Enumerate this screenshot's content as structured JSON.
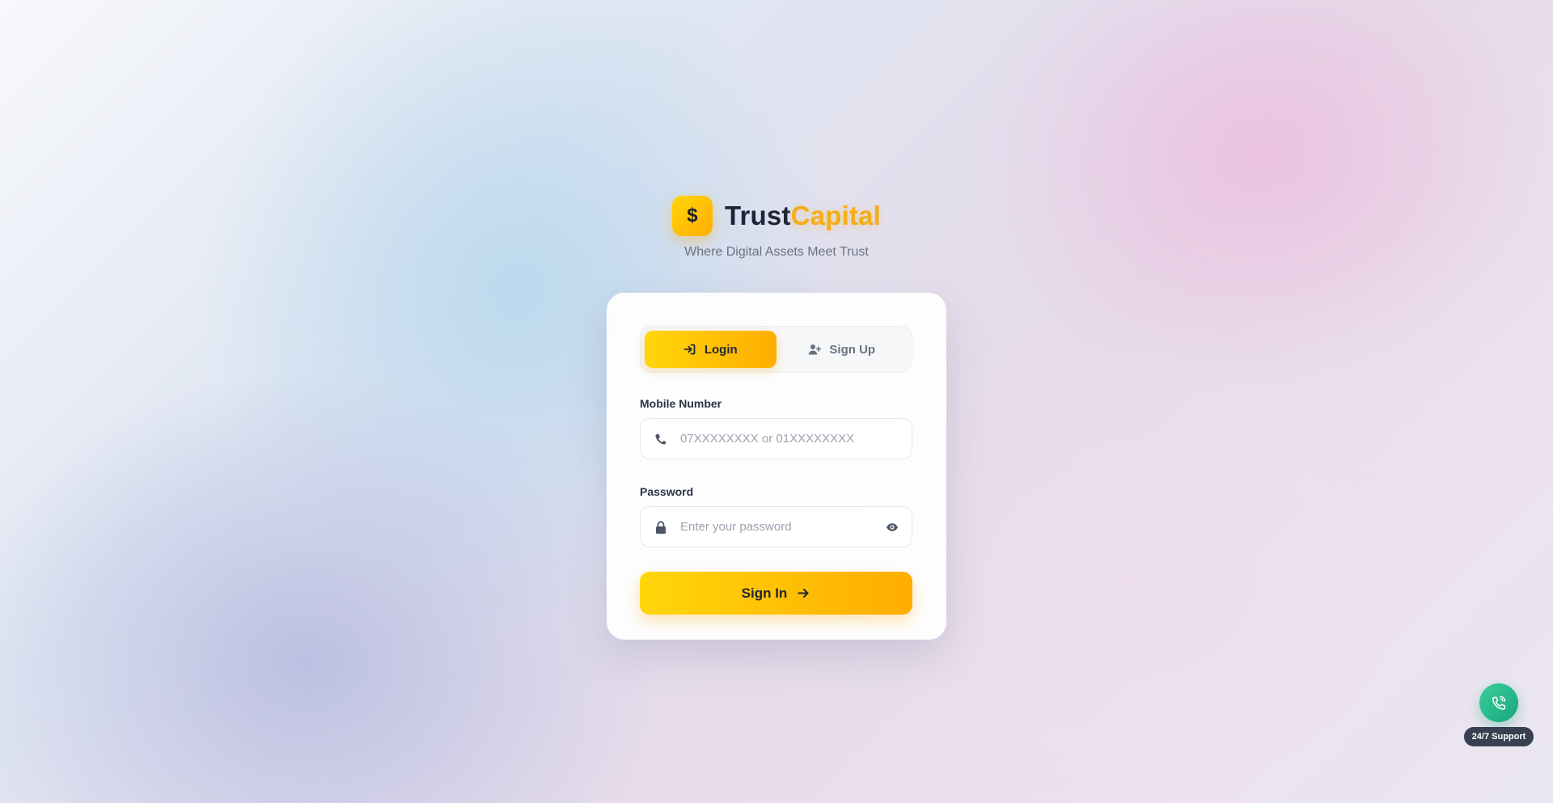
{
  "brand": {
    "logo_symbol": "$",
    "name_part1": "Trust",
    "name_part2": "Capital",
    "tagline": "Where Digital Assets Meet Trust"
  },
  "tabs": [
    {
      "label": "Login",
      "icon": "sign-in-icon",
      "active": true
    },
    {
      "label": "Sign Up",
      "icon": "user-plus-icon",
      "active": false
    }
  ],
  "form": {
    "mobile": {
      "label": "Mobile Number",
      "placeholder": "07XXXXXXXX or 01XXXXXXXX",
      "value": "",
      "icon": "phone-icon"
    },
    "password": {
      "label": "Password",
      "placeholder": "Enter your password",
      "value": "",
      "icon": "lock-icon",
      "toggle_icon": "eye-icon"
    },
    "submit_label": "Sign In",
    "submit_icon": "arrow-right-icon"
  },
  "support": {
    "label": "24/7 Support",
    "icon": "phone-call-icon"
  },
  "colors": {
    "accent_start": "#ffd60a",
    "accent_end": "#ffad00",
    "brand_highlight": "#f5ad16",
    "text_dark": "#1f2536",
    "muted": "#6b7280",
    "support_green": "#17a57a",
    "support_label_bg": "#374151"
  }
}
